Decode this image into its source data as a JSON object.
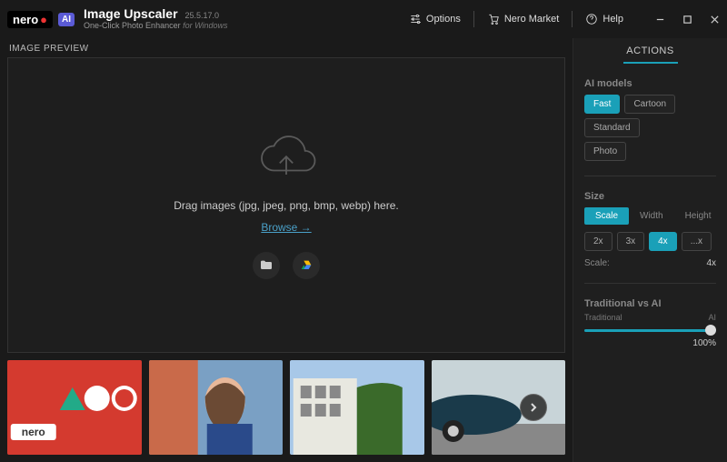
{
  "header": {
    "logo_text": "nero",
    "ai_badge": "AI",
    "title": "Image Upscaler",
    "version": "25.5.17.0",
    "subtitle": "One-Click Photo Enhancer",
    "platform": "for Windows",
    "options_label": "Options",
    "market_label": "Nero Market",
    "help_label": "Help"
  },
  "preview": {
    "section_label": "IMAGE PREVIEW",
    "drag_text": "Drag images (jpg, jpeg, png, bmp, webp) here.",
    "browse_label": "Browse →"
  },
  "actions": {
    "panel_title": "ACTIONS",
    "ai_models": {
      "label": "AI models",
      "items": [
        "Fast",
        "Cartoon",
        "Standard",
        "Photo"
      ],
      "active": "Fast"
    },
    "size": {
      "label": "Size",
      "modes": [
        "Scale",
        "Width",
        "Height"
      ],
      "active_mode": "Scale",
      "factors": [
        "2x",
        "3x",
        "4x",
        "...x"
      ],
      "active_factor": "4x",
      "scale_label": "Scale:",
      "scale_value": "4x"
    },
    "traditional": {
      "label": "Traditional vs AI",
      "left": "Traditional",
      "right": "AI",
      "percent": "100%"
    }
  }
}
